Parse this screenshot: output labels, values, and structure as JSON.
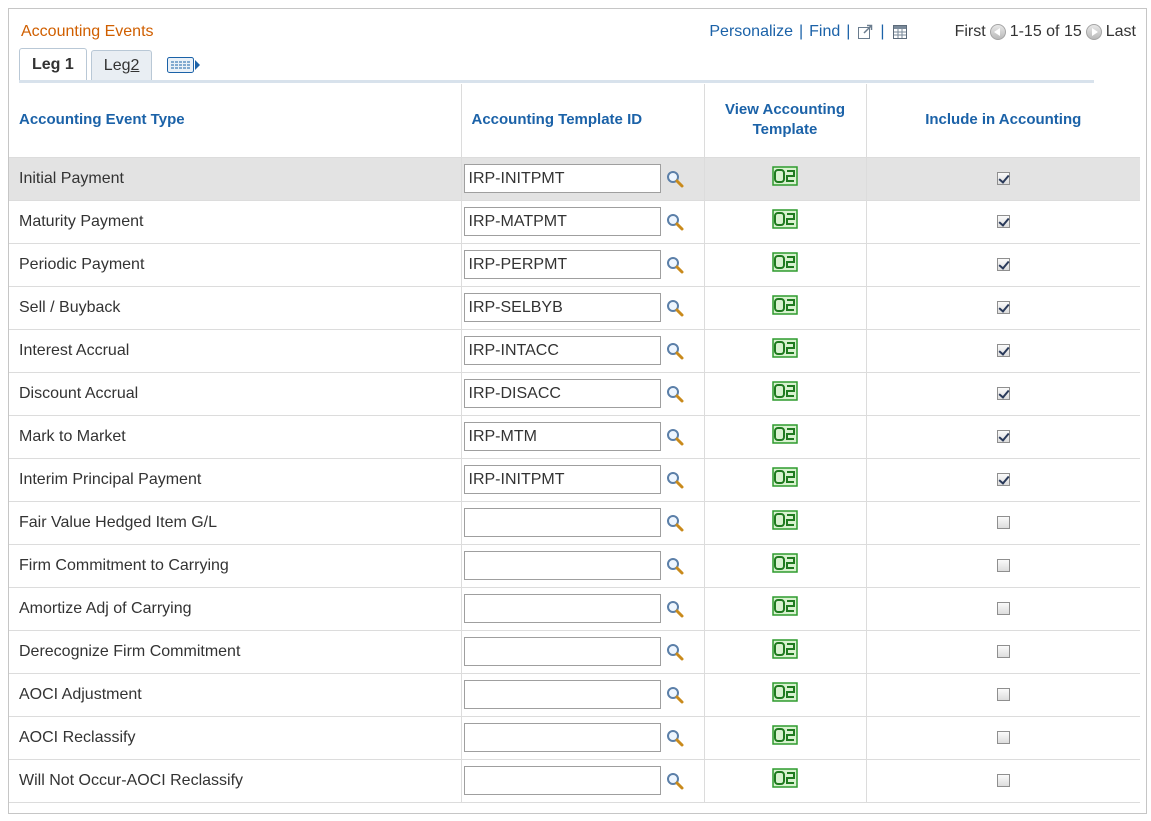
{
  "page": {
    "title": "Accounting Events"
  },
  "nav": {
    "personalize": "Personalize",
    "find": "Find",
    "sep": "|",
    "first": "First",
    "range": "1-15 of 15",
    "last": "Last"
  },
  "tabs": [
    {
      "label": "Leg 1",
      "active": true
    },
    {
      "label_prefix": "Leg ",
      "label_accel": "2",
      "active": false
    }
  ],
  "columns": {
    "event_type": "Accounting Event Type",
    "template_id": "Accounting Template ID",
    "view_template": "View Accounting Template",
    "include": "Include in Accounting"
  },
  "rows": [
    {
      "event": "Initial Payment",
      "template_id": "IRP-INITPMT",
      "include": true,
      "highlighted": true
    },
    {
      "event": "Maturity Payment",
      "template_id": "IRP-MATPMT",
      "include": true
    },
    {
      "event": "Periodic Payment",
      "template_id": "IRP-PERPMT",
      "include": true
    },
    {
      "event": "Sell / Buyback",
      "template_id": "IRP-SELBYB",
      "include": true
    },
    {
      "event": "Interest Accrual",
      "template_id": "IRP-INTACC",
      "include": true
    },
    {
      "event": "Discount Accrual",
      "template_id": "IRP-DISACC",
      "include": true
    },
    {
      "event": "Mark to Market",
      "template_id": "IRP-MTM",
      "include": true
    },
    {
      "event": "Interim Principal Payment",
      "template_id": "IRP-INITPMT",
      "include": true
    },
    {
      "event": "Fair Value Hedged Item G/L",
      "template_id": "",
      "include": false
    },
    {
      "event": "Firm Commitment to Carrying",
      "template_id": "",
      "include": false
    },
    {
      "event": "Amortize Adj of Carrying",
      "template_id": "",
      "include": false
    },
    {
      "event": "Derecognize Firm Commitment",
      "template_id": "",
      "include": false
    },
    {
      "event": "AOCI Adjustment",
      "template_id": "",
      "include": false
    },
    {
      "event": "AOCI Reclassify",
      "template_id": "",
      "include": false
    },
    {
      "event": "Will Not Occur-AOCI Reclassify",
      "template_id": "",
      "include": false
    }
  ],
  "icons": {
    "lookup": "magnifier-icon",
    "view": "view-template-icon",
    "new_window": "new-window-icon",
    "download": "download-grid-icon",
    "show_all_columns": "show-all-columns-icon",
    "prev": "previous-arrow-icon",
    "next": "next-arrow-icon"
  },
  "colors": {
    "title": "#d05f00",
    "link": "#1b62a8",
    "header_text": "#1b62a8",
    "highlight_row": "#e3e3e3",
    "view_icon": "#2e9b2e"
  }
}
